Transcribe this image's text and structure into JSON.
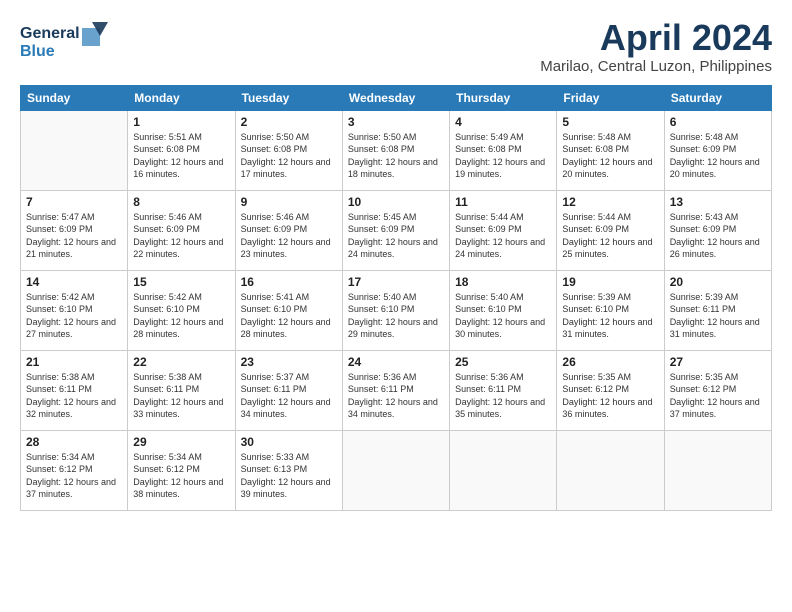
{
  "header": {
    "logo_line1": "General",
    "logo_line2": "Blue",
    "month": "April 2024",
    "location": "Marilao, Central Luzon, Philippines"
  },
  "days_of_week": [
    "Sunday",
    "Monday",
    "Tuesday",
    "Wednesday",
    "Thursday",
    "Friday",
    "Saturday"
  ],
  "weeks": [
    [
      {
        "day": null
      },
      {
        "day": "1",
        "sunrise": "5:51 AM",
        "sunset": "6:08 PM",
        "daylight": "12 hours and 16 minutes."
      },
      {
        "day": "2",
        "sunrise": "5:50 AM",
        "sunset": "6:08 PM",
        "daylight": "12 hours and 17 minutes."
      },
      {
        "day": "3",
        "sunrise": "5:50 AM",
        "sunset": "6:08 PM",
        "daylight": "12 hours and 18 minutes."
      },
      {
        "day": "4",
        "sunrise": "5:49 AM",
        "sunset": "6:08 PM",
        "daylight": "12 hours and 19 minutes."
      },
      {
        "day": "5",
        "sunrise": "5:48 AM",
        "sunset": "6:08 PM",
        "daylight": "12 hours and 20 minutes."
      },
      {
        "day": "6",
        "sunrise": "5:48 AM",
        "sunset": "6:09 PM",
        "daylight": "12 hours and 20 minutes."
      }
    ],
    [
      {
        "day": "7",
        "sunrise": "5:47 AM",
        "sunset": "6:09 PM",
        "daylight": "12 hours and 21 minutes."
      },
      {
        "day": "8",
        "sunrise": "5:46 AM",
        "sunset": "6:09 PM",
        "daylight": "12 hours and 22 minutes."
      },
      {
        "day": "9",
        "sunrise": "5:46 AM",
        "sunset": "6:09 PM",
        "daylight": "12 hours and 23 minutes."
      },
      {
        "day": "10",
        "sunrise": "5:45 AM",
        "sunset": "6:09 PM",
        "daylight": "12 hours and 24 minutes."
      },
      {
        "day": "11",
        "sunrise": "5:44 AM",
        "sunset": "6:09 PM",
        "daylight": "12 hours and 24 minutes."
      },
      {
        "day": "12",
        "sunrise": "5:44 AM",
        "sunset": "6:09 PM",
        "daylight": "12 hours and 25 minutes."
      },
      {
        "day": "13",
        "sunrise": "5:43 AM",
        "sunset": "6:09 PM",
        "daylight": "12 hours and 26 minutes."
      }
    ],
    [
      {
        "day": "14",
        "sunrise": "5:42 AM",
        "sunset": "6:10 PM",
        "daylight": "12 hours and 27 minutes."
      },
      {
        "day": "15",
        "sunrise": "5:42 AM",
        "sunset": "6:10 PM",
        "daylight": "12 hours and 28 minutes."
      },
      {
        "day": "16",
        "sunrise": "5:41 AM",
        "sunset": "6:10 PM",
        "daylight": "12 hours and 28 minutes."
      },
      {
        "day": "17",
        "sunrise": "5:40 AM",
        "sunset": "6:10 PM",
        "daylight": "12 hours and 29 minutes."
      },
      {
        "day": "18",
        "sunrise": "5:40 AM",
        "sunset": "6:10 PM",
        "daylight": "12 hours and 30 minutes."
      },
      {
        "day": "19",
        "sunrise": "5:39 AM",
        "sunset": "6:10 PM",
        "daylight": "12 hours and 31 minutes."
      },
      {
        "day": "20",
        "sunrise": "5:39 AM",
        "sunset": "6:11 PM",
        "daylight": "12 hours and 31 minutes."
      }
    ],
    [
      {
        "day": "21",
        "sunrise": "5:38 AM",
        "sunset": "6:11 PM",
        "daylight": "12 hours and 32 minutes."
      },
      {
        "day": "22",
        "sunrise": "5:38 AM",
        "sunset": "6:11 PM",
        "daylight": "12 hours and 33 minutes."
      },
      {
        "day": "23",
        "sunrise": "5:37 AM",
        "sunset": "6:11 PM",
        "daylight": "12 hours and 34 minutes."
      },
      {
        "day": "24",
        "sunrise": "5:36 AM",
        "sunset": "6:11 PM",
        "daylight": "12 hours and 34 minutes."
      },
      {
        "day": "25",
        "sunrise": "5:36 AM",
        "sunset": "6:11 PM",
        "daylight": "12 hours and 35 minutes."
      },
      {
        "day": "26",
        "sunrise": "5:35 AM",
        "sunset": "6:12 PM",
        "daylight": "12 hours and 36 minutes."
      },
      {
        "day": "27",
        "sunrise": "5:35 AM",
        "sunset": "6:12 PM",
        "daylight": "12 hours and 37 minutes."
      }
    ],
    [
      {
        "day": "28",
        "sunrise": "5:34 AM",
        "sunset": "6:12 PM",
        "daylight": "12 hours and 37 minutes."
      },
      {
        "day": "29",
        "sunrise": "5:34 AM",
        "sunset": "6:12 PM",
        "daylight": "12 hours and 38 minutes."
      },
      {
        "day": "30",
        "sunrise": "5:33 AM",
        "sunset": "6:13 PM",
        "daylight": "12 hours and 39 minutes."
      },
      {
        "day": null
      },
      {
        "day": null
      },
      {
        "day": null
      },
      {
        "day": null
      }
    ]
  ]
}
